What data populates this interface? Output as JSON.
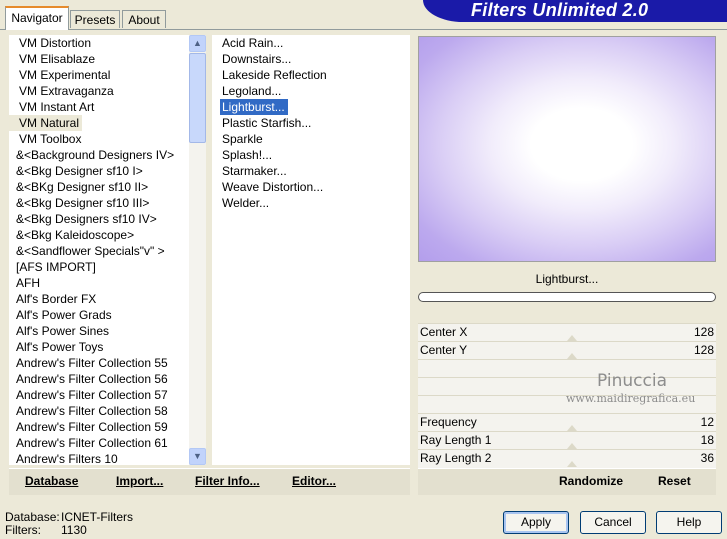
{
  "tabs": [
    "Navigator",
    "Presets",
    "About"
  ],
  "banner_title": "Filters Unlimited 2.0",
  "categories": [
    "VM Distortion",
    "VM Elisablaze",
    "VM Experimental",
    "VM Extravaganza",
    "VM Instant Art",
    "VM Natural",
    "VM Toolbox",
    "&<Background Designers IV>",
    "&<Bkg Designer sf10 I>",
    "&<BKg Designer sf10 II>",
    "&<Bkg Designer sf10 III>",
    "&<Bkg Designers sf10 IV>",
    "&<Bkg Kaleidoscope>",
    "&<Sandflower Specials\"v\" >",
    "[AFS IMPORT]",
    "AFH",
    "Alf's Border FX",
    "Alf's Power Grads",
    "Alf's Power Sines",
    "Alf's Power Toys",
    "Andrew's Filter Collection 55",
    "Andrew's Filter Collection 56",
    "Andrew's Filter Collection 57",
    "Andrew's Filter Collection 58",
    "Andrew's Filter Collection 59",
    "Andrew's Filter Collection 61",
    "Andrew's Filters 10"
  ],
  "selected_category": "VM Natural",
  "filters": [
    "Acid Rain...",
    "Downstairs...",
    "Lakeside Reflection",
    "Legoland...",
    "Lightburst...",
    "Plastic Starfish...",
    "Sparkle",
    "Splash!...",
    "Starmaker...",
    "Weave Distortion...",
    "Welder..."
  ],
  "selected_filter": "Lightburst...",
  "preview_label": "Lightburst...",
  "params": [
    {
      "name": "Center X",
      "value": "128"
    },
    {
      "name": "Center Y",
      "value": "128"
    },
    {
      "name": "Frequency",
      "value": "12"
    },
    {
      "name": "Ray Length 1",
      "value": "18"
    },
    {
      "name": "Ray Length 2",
      "value": "36"
    }
  ],
  "watermark": {
    "line1": "Pinuccia",
    "line2": "www.maidiregrafica.eu"
  },
  "left_buttons": [
    "Database",
    "Import...",
    "Filter Info...",
    "Editor..."
  ],
  "right_buttons": [
    "Randomize",
    "Reset"
  ],
  "status": {
    "database_label": "Database:",
    "database_value": "ICNET-Filters",
    "filters_label": "Filters:",
    "filters_value": "1130"
  },
  "dialog_buttons": [
    "Apply",
    "Cancel",
    "Help"
  ],
  "colors": {
    "banner": "#1a1aa8",
    "selection": "#316ac5",
    "preview_tint": "#b9a3ee"
  }
}
